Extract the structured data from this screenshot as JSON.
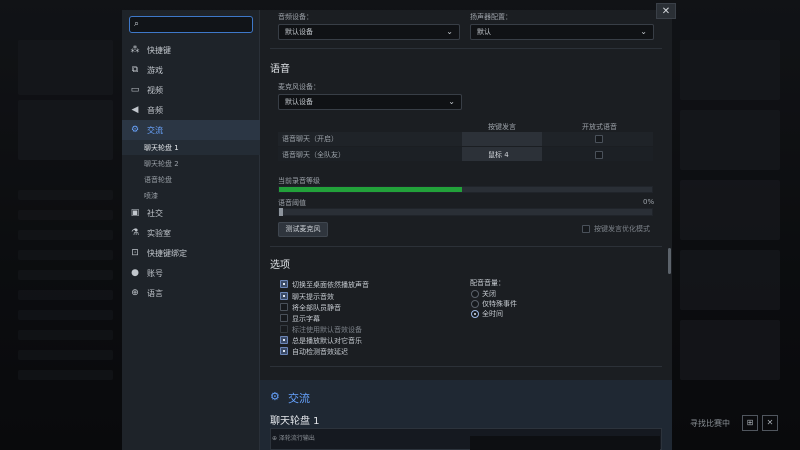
{
  "sidebar": {
    "search_placeholder": "",
    "items": [
      {
        "icon": "shortcut-icon",
        "glyph": "⁂",
        "label": "快捷键"
      },
      {
        "icon": "gamepad-icon",
        "glyph": "⧉",
        "label": "游戏"
      },
      {
        "icon": "monitor-icon",
        "glyph": "▭",
        "label": "视频"
      },
      {
        "icon": "speaker-icon",
        "glyph": "◀",
        "label": "音频"
      },
      {
        "icon": "gear-icon",
        "glyph": "⚙",
        "label": "交流"
      }
    ],
    "sub_items": [
      "聊天轮盘 1",
      "聊天轮盘 2",
      "语音轮盘",
      "喷漆"
    ],
    "items_after": [
      {
        "icon": "chat-icon",
        "glyph": "▣",
        "label": "社交"
      },
      {
        "icon": "flask-icon",
        "glyph": "⚗",
        "label": "实验室"
      },
      {
        "icon": "hotkey-icon",
        "glyph": "⊡",
        "label": "快捷键绑定"
      },
      {
        "icon": "user-icon",
        "glyph": "●",
        "label": "账号"
      },
      {
        "icon": "globe-icon",
        "glyph": "⊕",
        "label": "语言"
      }
    ]
  },
  "top": {
    "device_label": "音频设备：",
    "device_value": "默认设备",
    "speaker_label": "扬声器配置：",
    "speaker_value": "默认"
  },
  "voice": {
    "title": "语音",
    "mic_label": "麦克风设备：",
    "mic_value": "默认设备",
    "col_ptt": "按键发言",
    "col_open": "开放式语音",
    "rows": [
      {
        "label": "语音聊天（开启）",
        "key": ""
      },
      {
        "label": "语音聊天（全队友）",
        "key": "鼠标 4"
      }
    ],
    "level_label": "当前录音等级",
    "level_fraction": 0.49,
    "threshold_label": "语音阈值",
    "threshold_value": "0%",
    "threshold_fraction": 0.0,
    "test_button": "测试麦克风",
    "ptt_optimize_label": "按键发言优化模式"
  },
  "options": {
    "title": "选项",
    "checks": [
      {
        "label": "切换至桌面依然播放声音",
        "on": true,
        "enabled": true
      },
      {
        "label": "聊天提示音效",
        "on": true,
        "enabled": true
      },
      {
        "label": "将全部队员静音",
        "on": false,
        "enabled": true
      },
      {
        "label": "显示字幕",
        "on": false,
        "enabled": true
      },
      {
        "label": "标注使用默认音效设备",
        "on": false,
        "enabled": false
      },
      {
        "label": "总是播放默认对它音乐",
        "on": true,
        "enabled": true
      },
      {
        "label": "自动检测音效延迟",
        "on": true,
        "enabled": true
      }
    ],
    "volume_label": "配音音量：",
    "radios": [
      {
        "label": "关闭",
        "on": false
      },
      {
        "label": "仅特殊事件",
        "on": false
      },
      {
        "label": "全时间",
        "on": true
      }
    ]
  },
  "footer": {
    "title": "交流",
    "subtitle": "聊天轮盘 1",
    "strip_label": "⊕ 泽轮流行输出"
  },
  "close_glyph": "✕",
  "bottom_right_text": "寻找比赛中"
}
